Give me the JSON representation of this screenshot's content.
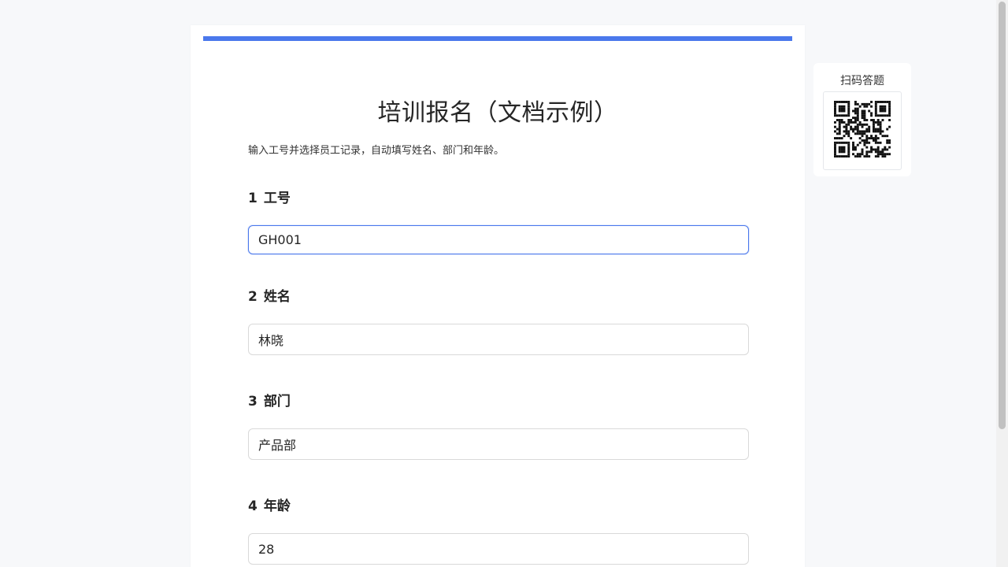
{
  "form": {
    "title": "培训报名（文档示例）",
    "description": "输入工号并选择员工记录，自动填写姓名、部门和年龄。",
    "accent_color": "#4a78ec",
    "questions": [
      {
        "number": "1",
        "label": "工号",
        "value": "GH001"
      },
      {
        "number": "2",
        "label": "姓名",
        "value": "林晓"
      },
      {
        "number": "3",
        "label": "部门",
        "value": "产品部"
      },
      {
        "number": "4",
        "label": "年龄",
        "value": "28"
      }
    ]
  },
  "qr": {
    "title": "扫码答题",
    "icon": "qr-code-icon"
  }
}
